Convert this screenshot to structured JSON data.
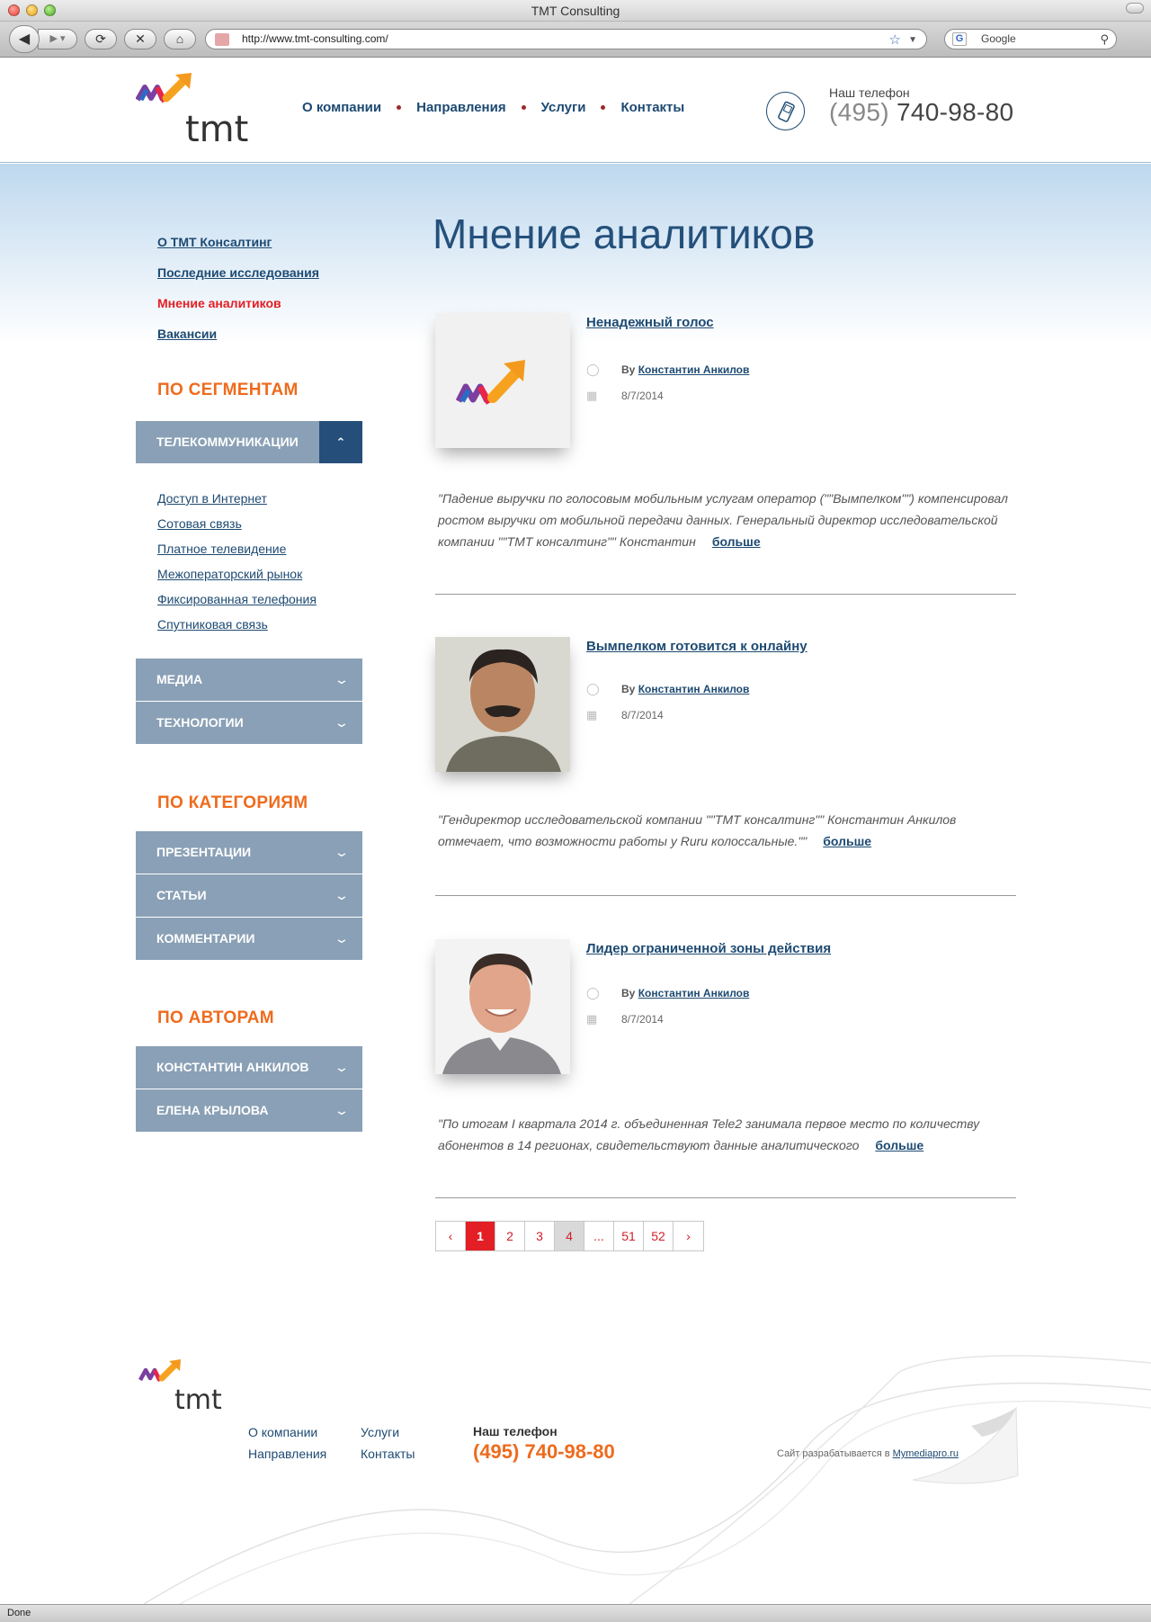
{
  "browser": {
    "window_title": "TMT Consulting",
    "url": "http://www.tmt-consulting.com/",
    "search_placeholder": "Google",
    "status": "Done"
  },
  "header": {
    "logo_text": "tmt",
    "nav": [
      "О компании",
      "Направления",
      "Услуги",
      "Контакты"
    ],
    "phone_label": "Наш телефон",
    "phone_code": "(495)",
    "phone_number": "740-98-80"
  },
  "sidebar": {
    "links": [
      {
        "label": "О ТМТ Консалтинг",
        "active": false
      },
      {
        "label": "Последние исследования",
        "active": false
      },
      {
        "label": "Мнение аналитиков",
        "active": true
      },
      {
        "label": "Вакансии",
        "active": false
      }
    ],
    "segments_title": "ПО СЕГМЕНТАМ",
    "segments_open": "ТЕЛЕКОММУНИКАЦИИ",
    "segment_sublinks": [
      "Доступ в Интернет",
      "Сотовая связь",
      "Платное телевидение",
      "Межоператорский рынок",
      "Фиксированная телефония",
      "Спутниковая связь"
    ],
    "segments_closed": [
      "МЕДИА",
      "ТЕХНОЛОГИИ"
    ],
    "categories_title": "ПО КАТЕГОРИЯМ",
    "categories": [
      "ПРЕЗЕНТАЦИИ",
      "СТАТЬИ",
      "КОММЕНТАРИИ"
    ],
    "authors_title": "ПО АВТОРАМ",
    "authors": [
      "КОНСТАНТИН АНКИЛОВ",
      "ЕЛЕНА КРЫЛОВА"
    ]
  },
  "main": {
    "title": "Мнение аналитиков",
    "by_label": "By",
    "more_label": "больше",
    "articles": [
      {
        "title": "Ненадежный голос",
        "author": "Константин Анкилов",
        "date": "8/7/2014",
        "excerpt": "\"Падение выручки по голосовым мобильным услугам оператор (\"\"Вымпелком\"\") компенсировал ростом выручки от мобильной передачи данных. Генеральный директор исследовательской компании \"\"ТМТ консалтинг\"\" Константин"
      },
      {
        "title": "Вымпелком готовится к онлайну",
        "author": "Константин Анкилов",
        "date": "8/7/2014",
        "excerpt": "\"Гендиректор исследовательской компании \"\"ТМТ консалтинг\"\" Константин Анкилов отмечает, что возможности работы у Ruru колоссальные.\"\""
      },
      {
        "title": "Лидер ограниченной зоны действия",
        "author": "Константин Анкилов",
        "date": "8/7/2014",
        "excerpt": "\"По итогам I квартала 2014 г. объединенная Tele2 занимала первое место по количеству абонентов в 14 регионах, свидетельствуют данные аналитического"
      }
    ],
    "pagination": {
      "prev": "‹",
      "pages": [
        "1",
        "2",
        "3",
        "4",
        "...",
        "51",
        "52"
      ],
      "current": "1",
      "next": "›"
    }
  },
  "footer": {
    "links_col1": [
      "О компании",
      "Направления"
    ],
    "links_col2": [
      "Услуги",
      "Контакты"
    ],
    "phone_label": "Наш телефон",
    "phone": "(495) 740-98-80",
    "credit_text": "Сайт разрабатывается в",
    "credit_link": "Mymediapro.ru"
  },
  "colors": {
    "brand_blue": "#1d4a72",
    "accent_orange": "#ee6b1d",
    "accent_red": "#e31e24",
    "accordion_gray": "#8aa0b6"
  }
}
